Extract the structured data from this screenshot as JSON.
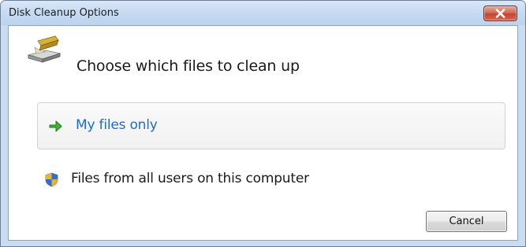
{
  "window": {
    "title": "Disk Cleanup Options",
    "close_icon": "close-icon"
  },
  "header": {
    "icon": "disk-cleanup-icon",
    "title": "Choose which files to clean up"
  },
  "options": [
    {
      "label": "My files only",
      "icon": "green-arrow-icon",
      "state": "focused"
    },
    {
      "label": "Files from all users on this computer",
      "icon": "uac-shield-icon",
      "state": "normal"
    }
  ],
  "buttons": {
    "cancel": "Cancel"
  },
  "colors": {
    "link_blue": "#1a6bd7",
    "close_red": "#c4442e",
    "frame_blue": "#c9dcf2"
  }
}
